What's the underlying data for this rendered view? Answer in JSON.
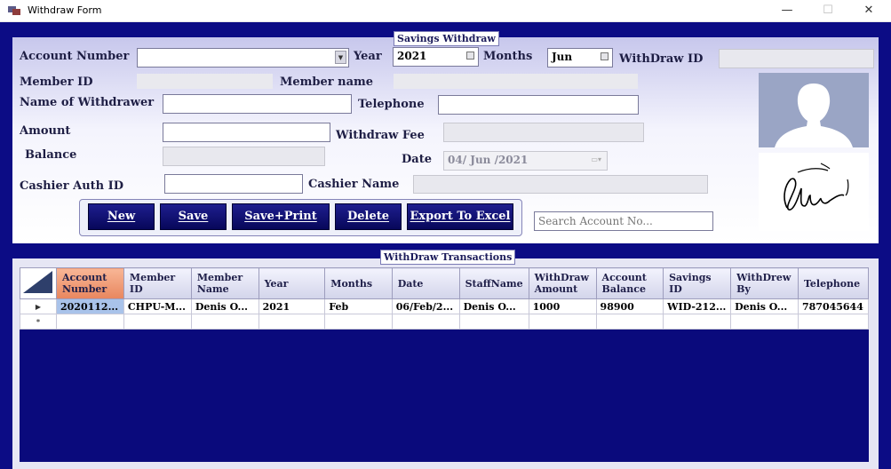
{
  "window": {
    "title": "Withdraw Form",
    "minimize": "—",
    "maximize": "☐",
    "close": "✕"
  },
  "form": {
    "group_title": "Savings Withdraw",
    "account_number_label": "Account Number",
    "account_number_value": "",
    "year_label": "Year",
    "year_value": "2021",
    "months_label": "Months",
    "months_value": "Jun",
    "withdraw_id_label": "WithDraw ID",
    "withdraw_id_value": "",
    "member_id_label": "Member ID",
    "member_name_label": "Member name",
    "name_of_withdrawer_label": "Name of Withdrawer",
    "telephone_label": "Telephone",
    "amount_label": "Amount",
    "withdraw_fee_label": "Withdraw Fee",
    "balance_label": "Balance",
    "date_label": "Date",
    "date_value": "04/ Jun /2021",
    "cashier_auth_id_label": "Cashier Auth ID",
    "cashier_name_label": "Cashier Name",
    "search_placeholder": "Search Account No..."
  },
  "buttons": {
    "new": "New",
    "save": "Save",
    "save_print": "Save+Print",
    "delete": "Delete",
    "export": "Export To Excel"
  },
  "icons": {
    "avatar": "user-silhouette-icon",
    "signature": "signature-image",
    "app": "app-icon"
  },
  "grid": {
    "group_title": "WithDraw Transactions",
    "columns": [
      [
        "Account",
        "Number"
      ],
      [
        "Member",
        "ID"
      ],
      [
        "Member",
        "Name"
      ],
      [
        "Year"
      ],
      [
        "Months"
      ],
      [
        "Date"
      ],
      [
        "StaffName"
      ],
      [
        "WithDraw",
        "Amount"
      ],
      [
        "Account",
        "Balance"
      ],
      [
        "Savings",
        "ID"
      ],
      [
        "WithDrew",
        "By"
      ],
      [
        "Telephone"
      ]
    ],
    "rows": [
      [
        "2020112...",
        "CHPU-M...",
        "Denis O...",
        "2021",
        "Feb",
        "06/Feb/2...",
        "Denis O...",
        "1000",
        "98900",
        "WID-212...",
        "Denis O...",
        "787045644"
      ]
    ],
    "current_row_marker": "▶",
    "new_row_marker": "*"
  },
  "colors": {
    "frame": "#0c0c85",
    "button": "#0e0e6e",
    "selected_header": "#f0a07a"
  }
}
